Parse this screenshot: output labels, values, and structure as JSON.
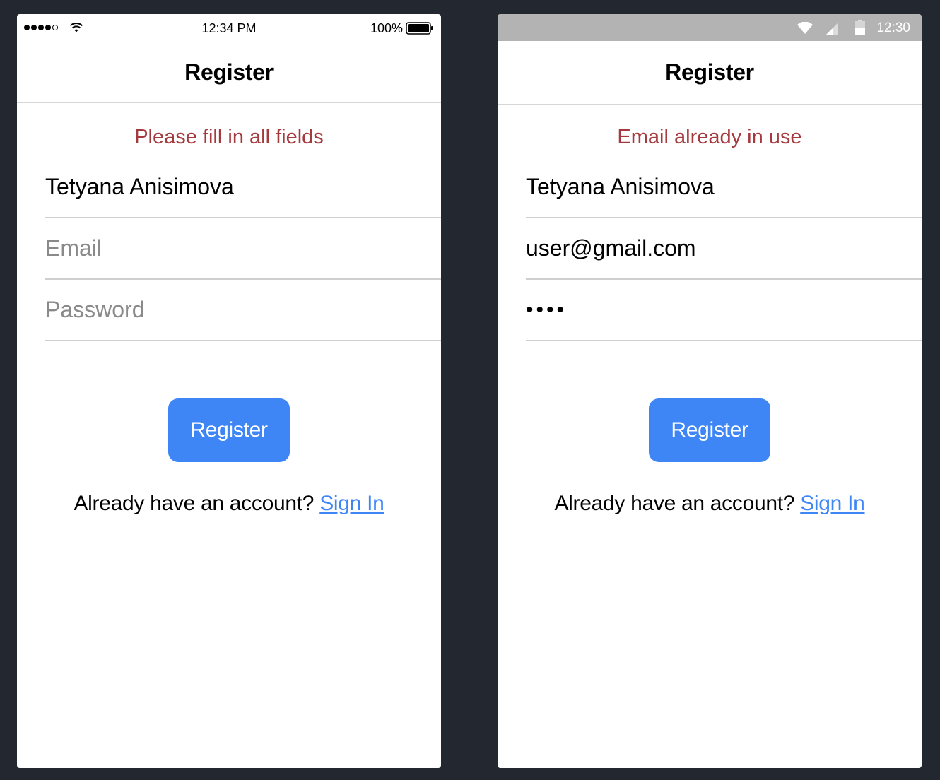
{
  "ios": {
    "status": {
      "time": "12:34 PM",
      "battery": "100%"
    },
    "title": "Register",
    "error": "Please fill in all fields",
    "fields": {
      "name_value": "Tetyana Anisimova",
      "email_placeholder": "Email",
      "password_placeholder": "Password"
    },
    "button": "Register",
    "signin_prompt": "Already have an account?",
    "signin_link": "Sign In"
  },
  "android": {
    "status": {
      "time": "12:30"
    },
    "title": "Register",
    "error": "Email already in use",
    "fields": {
      "name_value": "Tetyana Anisimova",
      "email_value": "user@gmail.com",
      "password_value": "••••"
    },
    "button": "Register",
    "signin_prompt": "Already have an account?",
    "signin_link": "Sign In"
  },
  "colors": {
    "background": "#232830",
    "error": "#a53a3e",
    "accent": "#3e86f6",
    "android_statusbar": "#b3b3b3"
  },
  "icons": [
    "signal-dots-icon",
    "wifi-icon",
    "battery-icon",
    "cell-signal-icon"
  ]
}
